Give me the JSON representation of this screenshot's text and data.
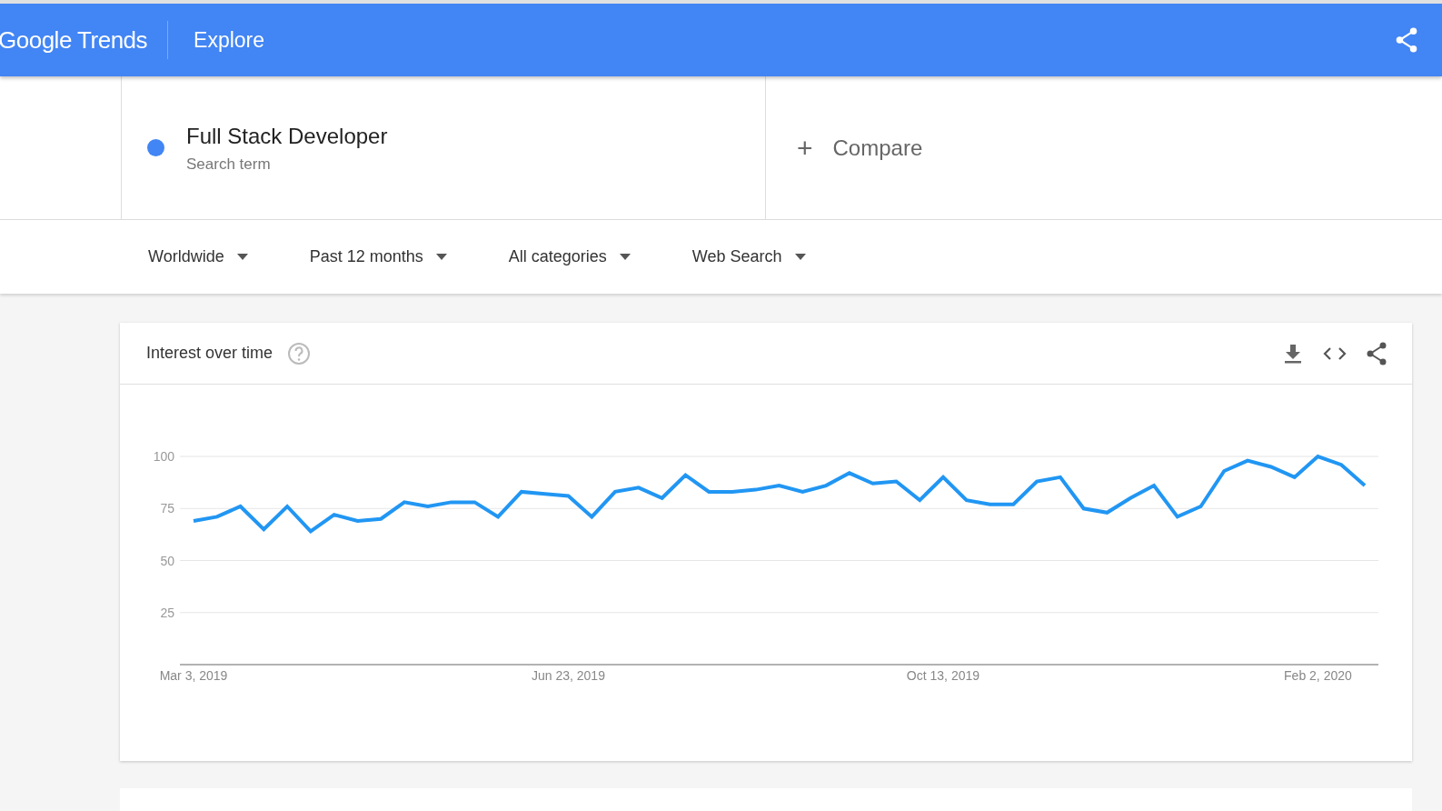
{
  "header": {
    "logo": "Google Trends",
    "title": "Explore"
  },
  "search_term": {
    "name": "Full Stack Developer",
    "type": "Search term",
    "color": "#4285f4"
  },
  "compare": {
    "icon": "+",
    "label": "Compare"
  },
  "filters": [
    {
      "label": "Worldwide"
    },
    {
      "label": "Past 12 months"
    },
    {
      "label": "All categories"
    },
    {
      "label": "Web Search"
    }
  ],
  "interest_over_time": {
    "title": "Interest over time",
    "chart_data": {
      "type": "line",
      "grid": true,
      "categories": [
        "Mar 3, 2019",
        null,
        null,
        null,
        null,
        null,
        null,
        null,
        null,
        null,
        null,
        null,
        null,
        null,
        null,
        null,
        "Jun 23, 2019",
        null,
        null,
        null,
        null,
        null,
        null,
        null,
        null,
        null,
        null,
        null,
        null,
        null,
        null,
        null,
        "Oct 13, 2019",
        null,
        null,
        null,
        null,
        null,
        null,
        null,
        null,
        null,
        null,
        null,
        null,
        null,
        null,
        null,
        "Feb 2, 2020",
        null,
        null
      ],
      "ylim": [
        0,
        100
      ],
      "yticks": [
        25,
        50,
        75,
        100
      ],
      "series": [
        {
          "color": "#2196f3",
          "values": [
            69,
            71,
            76,
            65,
            76,
            64,
            72,
            69,
            70,
            78,
            76,
            78,
            78,
            71,
            83,
            82,
            81,
            71,
            83,
            85,
            80,
            91,
            83,
            83,
            84,
            86,
            83,
            86,
            92,
            87,
            88,
            79,
            90,
            79,
            77,
            77,
            88,
            90,
            75,
            73,
            80,
            86,
            71,
            76,
            93,
            98,
            95,
            90,
            100,
            96,
            86
          ]
        }
      ]
    }
  }
}
